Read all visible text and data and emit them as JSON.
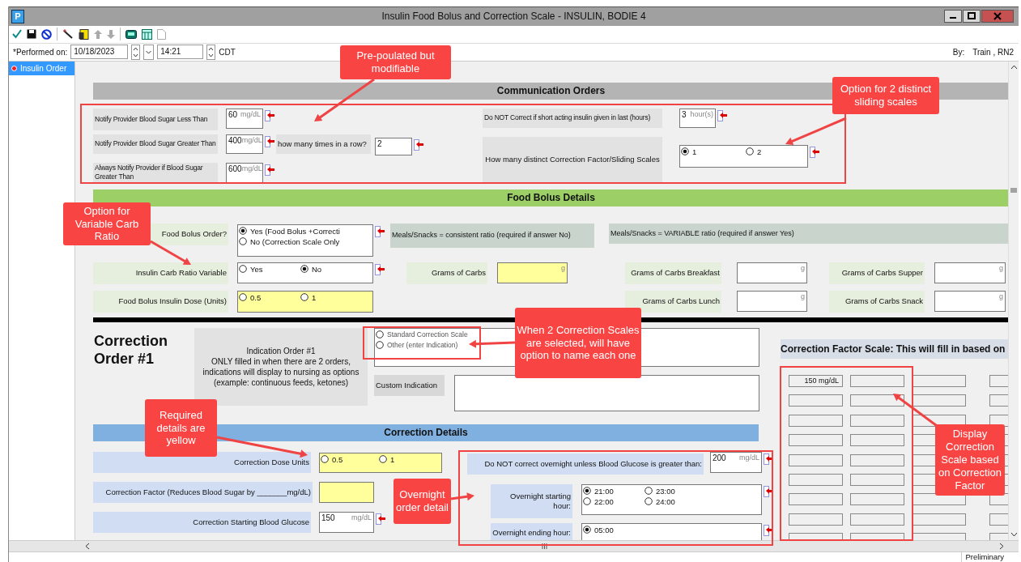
{
  "window": {
    "logo_letter": "P",
    "title": "Insulin Food Bolus and Correction Scale - INSULIN, BODIE 4"
  },
  "header": {
    "performed_label": "*Performed on:",
    "date": "10/18/2023",
    "time": "14:21",
    "timezone": "CDT",
    "by_label": "By:",
    "by_value": "Train , RN2"
  },
  "sidebar": {
    "items": [
      {
        "label": "Insulin Order",
        "selected": true
      }
    ]
  },
  "form": {
    "items": [
      {
        "kind": "header",
        "text": "Communication Orders"
      },
      {
        "kind": "label",
        "text": "Notify Provider Blood Sugar Less Than"
      },
      {
        "kind": "input",
        "value": "60",
        "unit": "mg/dL",
        "required": false
      },
      {
        "kind": "label",
        "text": "Do NOT Correct if short acting insulin given in last (hours)"
      },
      {
        "kind": "input",
        "value": "3",
        "unit": "hour(s)",
        "required": false
      },
      {
        "kind": "label",
        "text": "Notify Provider Blood Sugar Greater Than"
      },
      {
        "kind": "input",
        "value": "400",
        "unit": "mg/dL",
        "required": false
      },
      {
        "kind": "label",
        "text": "how many times in a row?"
      },
      {
        "kind": "input",
        "value": "2",
        "required": false
      },
      {
        "kind": "label",
        "text": "How many distinct Correction Factor/Sliding Scales"
      },
      {
        "kind": "radio",
        "required": false,
        "options": [
          {
            "label": "1",
            "selected": true
          },
          {
            "label": "2",
            "selected": false
          }
        ]
      },
      {
        "kind": "label",
        "text": "Always Notify Provider if Blood Sugar Greater Than"
      },
      {
        "kind": "input",
        "value": "600",
        "unit": "mg/dL",
        "required": false
      },
      {
        "kind": "header",
        "text": "Food Bolus Details"
      },
      {
        "kind": "label",
        "text": "Food Bolus Order?"
      },
      {
        "kind": "radio",
        "required": false,
        "options": [
          {
            "label": "Yes (Food Bolus +Correcti",
            "selected": true
          },
          {
            "label": "No (Correction Scale Only",
            "selected": false
          }
        ]
      },
      {
        "kind": "label",
        "text": "Meals/Snacks = consistent ratio (required if answer No)"
      },
      {
        "kind": "label",
        "text": "Meals/Snacks = VARIABLE ratio (required if answer Yes)"
      },
      {
        "kind": "label",
        "text": "Insulin Carb Ratio Variable"
      },
      {
        "kind": "radio",
        "required": false,
        "options": [
          {
            "label": "Yes",
            "selected": false
          },
          {
            "label": "No",
            "selected": true
          }
        ]
      },
      {
        "kind": "label",
        "text": "Grams of Carbs"
      },
      {
        "kind": "input",
        "unit": "g",
        "required": true
      },
      {
        "kind": "label",
        "text": "Grams of Carbs Breakfast"
      },
      {
        "kind": "input",
        "unit": "g",
        "required": false
      },
      {
        "kind": "label",
        "text": "Grams of Carbs Supper"
      },
      {
        "kind": "input",
        "unit": "g",
        "required": false
      },
      {
        "kind": "label",
        "text": "Food Bolus Insulin Dose (Units)"
      },
      {
        "kind": "radio",
        "required": true,
        "options": [
          {
            "label": "0.5",
            "selected": false
          },
          {
            "label": "1",
            "selected": false
          }
        ]
      },
      {
        "kind": "label",
        "text": "Grams of Carbs Lunch"
      },
      {
        "kind": "input",
        "unit": "g",
        "required": false
      },
      {
        "kind": "label",
        "text": "Grams of Carbs Snack"
      },
      {
        "kind": "input",
        "unit": "g",
        "required": false
      },
      {
        "kind": "title",
        "text": "Correction Order #1"
      },
      {
        "kind": "label",
        "text": "Indication Order #1\nONLY filled in when there are 2 orders,\nindications will display to nursing as options\n(example: continuous feeds, ketones)"
      },
      {
        "kind": "radio",
        "required": false,
        "options": [
          {
            "label": "Standard Correction Scale",
            "selected": false
          },
          {
            "label": "Other (enter Indication)",
            "selected": false
          }
        ]
      },
      {
        "kind": "label",
        "text": "Custom Indication"
      },
      {
        "kind": "textarea"
      },
      {
        "kind": "header",
        "text": "Correction Factor Scale:  This will fill in based on"
      },
      {
        "kind": "header",
        "text": "Correction Details"
      },
      {
        "kind": "label",
        "text": "Correction Dose Units"
      },
      {
        "kind": "radio",
        "required": true,
        "options": [
          {
            "label": "0.5",
            "selected": false
          },
          {
            "label": "1",
            "selected": false
          }
        ]
      },
      {
        "kind": "label",
        "text": "Do NOT correct overnight unless Blood Glucose is greater than:"
      },
      {
        "kind": "input",
        "value": "200",
        "unit": "mg/dL",
        "required": false
      },
      {
        "kind": "label",
        "text": "Correction Factor (Reduces Blood Sugar by _______mg/dL)"
      },
      {
        "kind": "input",
        "required": true
      },
      {
        "kind": "label",
        "text": "Overnight starting hour:"
      },
      {
        "kind": "radio",
        "required": false,
        "options": [
          {
            "label": "21:00",
            "selected": true
          },
          {
            "label": "23:00",
            "selected": false
          },
          {
            "label": "22:00",
            "selected": false
          },
          {
            "label": "24:00",
            "selected": false
          }
        ]
      },
      {
        "kind": "label",
        "text": "Correction Starting Blood Glucose"
      },
      {
        "kind": "input",
        "value": "150",
        "unit": "mg/dL",
        "required": false
      },
      {
        "kind": "label",
        "text": "Overnight ending hour:"
      },
      {
        "kind": "radio",
        "required": false,
        "options": [
          {
            "label": "05:00",
            "selected": true
          }
        ]
      }
    ]
  },
  "scale": {
    "first_value": "150 mg/dL"
  },
  "annotations": [
    {
      "text": "Pre-poulated but modifiable"
    },
    {
      "text": "Option for 2 distinct sliding scales"
    },
    {
      "text": "Option for Variable Carb Ratio"
    },
    {
      "text": "When 2 Correction Scales are selected, will have option to name each one"
    },
    {
      "text": "Required details are yellow"
    },
    {
      "text": "Overnight order detail"
    },
    {
      "text": "Display Correction Scale based on Correction Factor"
    }
  ],
  "status_bar": {
    "text": "Preliminary"
  }
}
